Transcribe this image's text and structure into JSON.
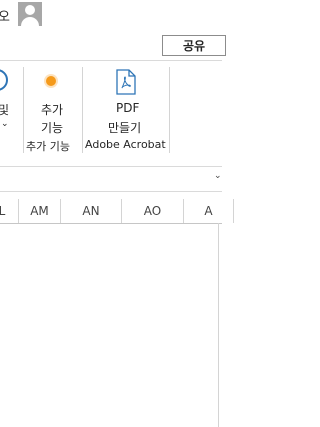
{
  "account": {
    "user_name": "오",
    "share_label": "공유"
  },
  "ribbon": {
    "partial_group": {
      "label": "및",
      "chevron": "⌄"
    },
    "addins": {
      "label_line1": "추가",
      "label_line2": "기능",
      "group_label": "추가 기능",
      "icon": "orange-dot-icon"
    },
    "acrobat": {
      "label_line1": "PDF",
      "label_line2": "만들기",
      "group_label": "Adobe Acrobat",
      "icon": "pdf-document-icon"
    },
    "scroll_chevron": "⌄"
  },
  "formula_bar": {
    "chevron": "⌄"
  },
  "sheet": {
    "columns": [
      "L",
      "AM",
      "AN",
      "AO",
      "A"
    ]
  },
  "colors": {
    "accent_blue": "#2e75b6",
    "addin_orange": "#f59a1b"
  }
}
